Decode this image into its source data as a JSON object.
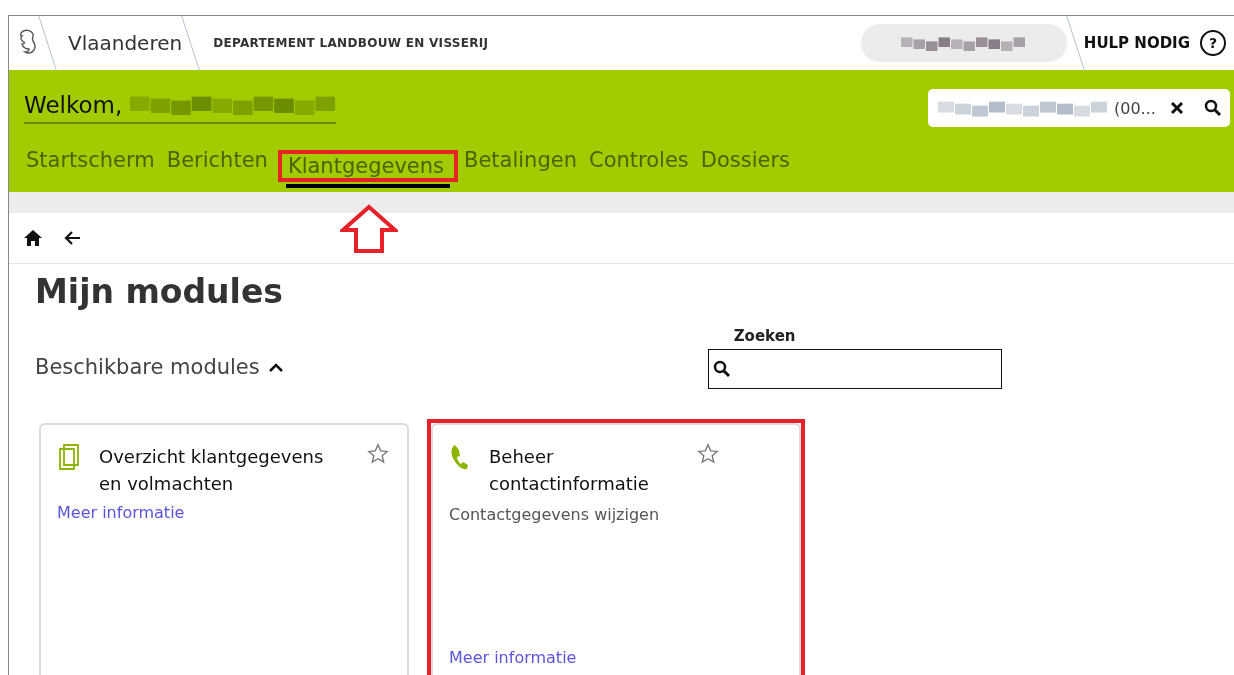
{
  "header": {
    "brand": "Vlaanderen",
    "department": "DEPARTEMENT LANDBOUW EN VISSERIJ",
    "help": "HULP NODIG",
    "help_icon": "?"
  },
  "banner": {
    "welcome": "Welkom,",
    "search_value": "(00..."
  },
  "tabs": [
    {
      "label": "Startscherm",
      "selected": false,
      "highlighted": false
    },
    {
      "label": "Berichten",
      "selected": false,
      "highlighted": false
    },
    {
      "label": "Klantgegevens",
      "selected": true,
      "highlighted": true
    },
    {
      "label": "Betalingen",
      "selected": false,
      "highlighted": false
    },
    {
      "label": "Controles",
      "selected": false,
      "highlighted": false
    },
    {
      "label": "Dossiers",
      "selected": false,
      "highlighted": false
    }
  ],
  "page": {
    "title": "Mijn modules",
    "section": "Beschikbare modules",
    "expanded": true,
    "search_label": "Zoeken"
  },
  "modules": [
    {
      "kind": "documents",
      "title": "Overzicht klantgegevens en volmachten",
      "more": "Meer informatie",
      "highlighted": false
    },
    {
      "kind": "phone",
      "title": "Beheer contactinformatie",
      "description": "Contactgegevens wijzigen",
      "more": "Meer informatie",
      "highlighted": true
    }
  ]
}
